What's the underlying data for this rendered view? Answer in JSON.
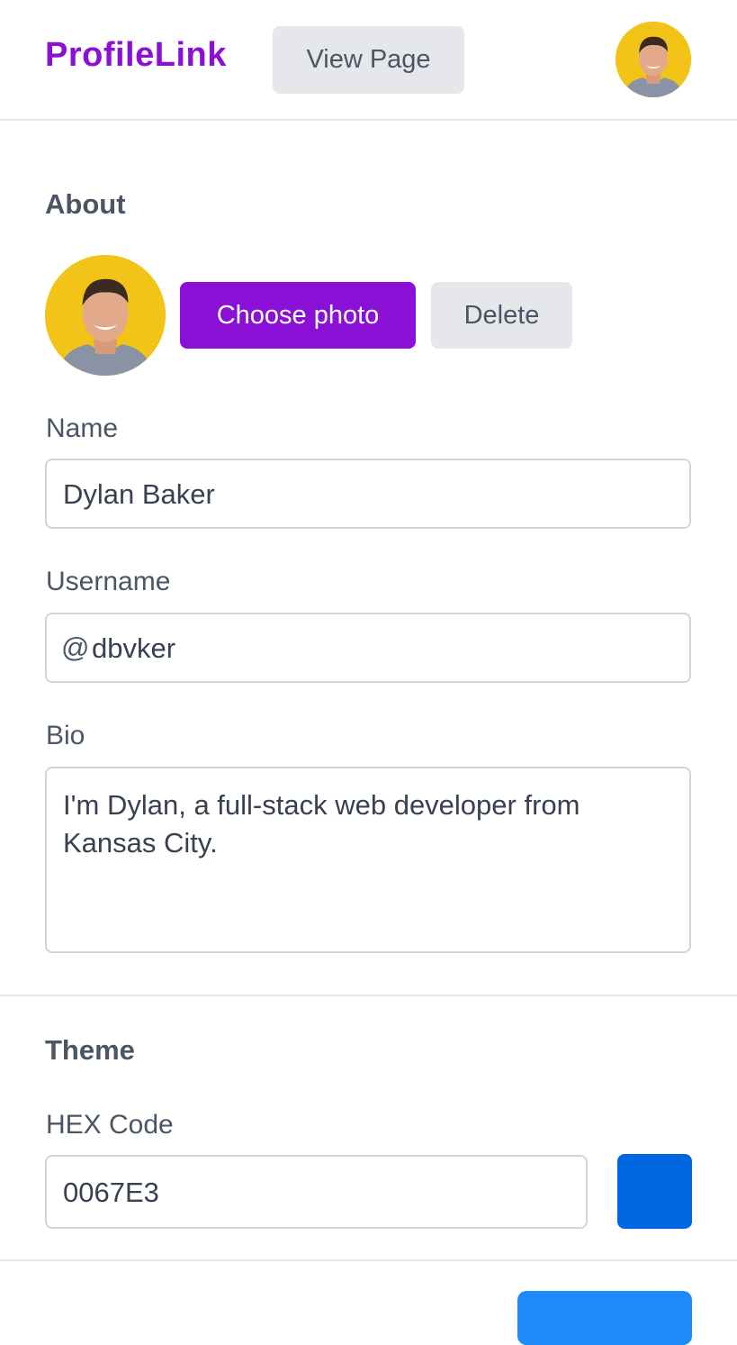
{
  "header": {
    "brand": "ProfileLink",
    "view_page_label": "View Page"
  },
  "about": {
    "title": "About",
    "choose_photo_label": "Choose photo",
    "delete_label": "Delete",
    "name_label": "Name",
    "name_value": "Dylan Baker",
    "username_label": "Username",
    "username_prefix": "@",
    "username_value": "dbvker",
    "bio_label": "Bio",
    "bio_value": "I'm Dylan, a full-stack web developer from Kansas City."
  },
  "theme": {
    "title": "Theme",
    "hex_label": "HEX Code",
    "hex_value": "0067E3",
    "swatch_color": "#0067E3"
  },
  "colors": {
    "brand": "#8B10D6",
    "bottom_button": "#1D8CF8"
  }
}
